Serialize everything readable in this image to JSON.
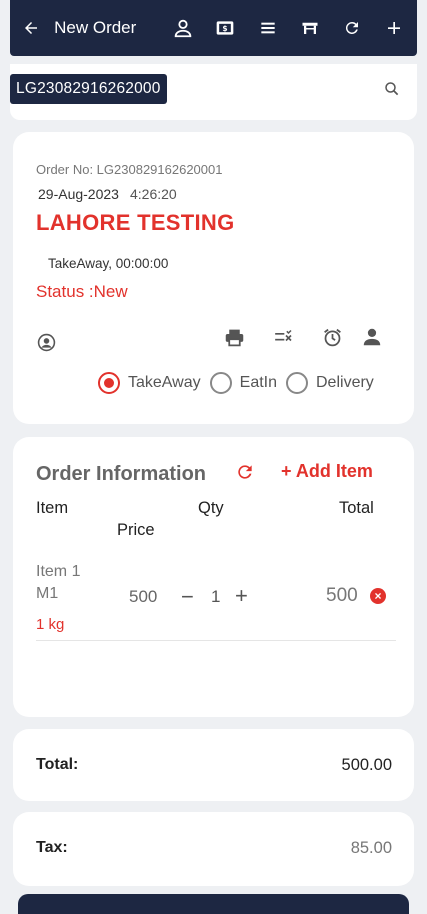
{
  "header": {
    "title": "New Order",
    "icons": [
      "back-arrow-icon",
      "person-icon",
      "cash-icon",
      "menu-icon",
      "table-icon",
      "refresh-icon",
      "plus-icon"
    ]
  },
  "search": {
    "order_code": "LG23082916262000"
  },
  "order": {
    "number": "Order No: LG230829162620001",
    "date": "29-Aug-2023",
    "time": "4:26:20",
    "customer": "LAHORE TESTING",
    "type_time": "TakeAway, 00:00:00",
    "status": "Status :New",
    "order_types": [
      "TakeAway",
      "EatIn",
      "Delivery"
    ],
    "selected_type": "TakeAway"
  },
  "order_info": {
    "title": "Order Information",
    "add_item_label": "+ Add Item",
    "columns": {
      "item": "Item",
      "price": "Price",
      "qty": "Qty",
      "total": "Total"
    },
    "items": [
      {
        "name_line1": "Item 1",
        "name_line2": "M1",
        "unit": "1 kg",
        "price": "500",
        "qty": "1",
        "total": "500"
      }
    ]
  },
  "summary": {
    "total_label": "Total:",
    "total_value": "500.00",
    "tax_label": "Tax:",
    "tax_value": "85.00"
  },
  "colors": {
    "primary": "#1d2742",
    "accent": "#e2322c",
    "background": "#eef0f3"
  }
}
